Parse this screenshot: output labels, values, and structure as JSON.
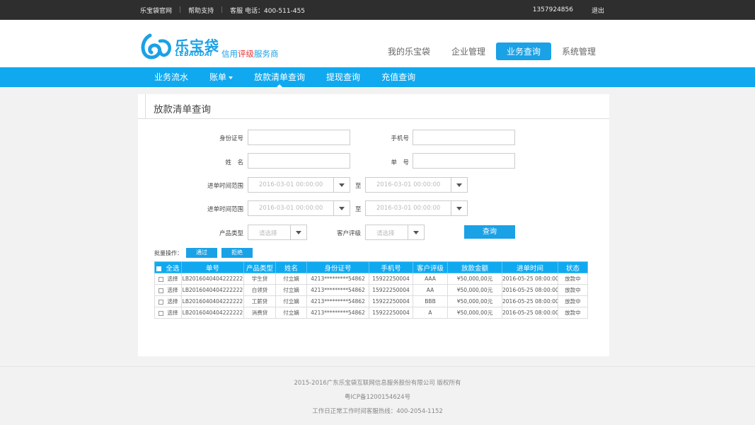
{
  "topbar": {
    "links": [
      "乐宝袋官网",
      "帮助支持",
      "客服  电话：400-511-455"
    ],
    "phone": "1357924856",
    "logout": "退出"
  },
  "logo": {
    "brand": "乐宝袋",
    "pinyin": "LEBAODAI",
    "slogan_pre": "信用",
    "slogan_red": "评级",
    "slogan_post": "服务商"
  },
  "main_nav": [
    "我的乐宝袋",
    "企业管理",
    "业务查询",
    "系统管理"
  ],
  "main_nav_active": "业务查询",
  "sub_nav": [
    "业务流水",
    "账单",
    "放款清单查询",
    "提现查询",
    "充值查询"
  ],
  "sub_nav_active": "放款清单查询",
  "panel_title": "放款清单查询",
  "form": {
    "id_label": "身份证号",
    "phone_label": "手机号",
    "name_label": "姓　名",
    "order_label": "单　号",
    "time_label_1": "进单时间范围",
    "time_label_2": "进单时间范围",
    "date_value": "2016-03-01  00:00:00",
    "to": "至",
    "product_label": "产品类型",
    "product_placeholder": "请选择",
    "rating_label": "客户评级",
    "rating_placeholder": "请选择",
    "query_button": "查询"
  },
  "batch": {
    "label": "批量操作：",
    "approve": "通过",
    "reject": "拒绝"
  },
  "table": {
    "columns": [
      "全选",
      "单号",
      "产品类型",
      "姓名",
      "身份证号",
      "手机号",
      "客户评级",
      "放款金额",
      "进单时间",
      "状态"
    ],
    "rows": [
      {
        "select": "选择",
        "order": "LB2016040404222222",
        "product": "学生贷",
        "name": "付立嫡",
        "id": "4213*********54862",
        "phone": "15922250004",
        "rating": "AAA",
        "amount": "¥50,000,00元",
        "time": "2016-05-25 08:00:00",
        "status": "放款中"
      },
      {
        "select": "选择",
        "order": "LB2016040404222222",
        "product": "白领贷",
        "name": "付立嫡",
        "id": "4213*********54862",
        "phone": "15922250004",
        "rating": "AA",
        "amount": "¥50,000,00元",
        "time": "2016-05-25 08:00:00",
        "status": "放款中"
      },
      {
        "select": "选择",
        "order": "LB2016040404222222",
        "product": "工薪贷",
        "name": "付立嫡",
        "id": "4213*********54862",
        "phone": "15922250004",
        "rating": "BBB",
        "amount": "¥50,000,00元",
        "time": "2016-05-25 08:00:00",
        "status": "放款中"
      },
      {
        "select": "选择",
        "order": "LB2016040404222222",
        "product": "消费贷",
        "name": "付立嫡",
        "id": "4213*********54862",
        "phone": "15922250004",
        "rating": "A",
        "amount": "¥50,000,00元",
        "time": "2016-05-25 08:00:00",
        "status": "放款中"
      }
    ]
  },
  "footer": {
    "copyright": "2015-2016广东乐宝袋互联网信息服务股份有限公司 版权所有",
    "icp": "粤ICP备1200154624号",
    "hotline": "工作日正常工作时间客服热线：400-2054-1152"
  },
  "colors": {
    "accent": "#1aa1e6",
    "subnav": "#10a9ef",
    "topbar": "#2e2e2e",
    "slogan_red": "#e4393c"
  }
}
